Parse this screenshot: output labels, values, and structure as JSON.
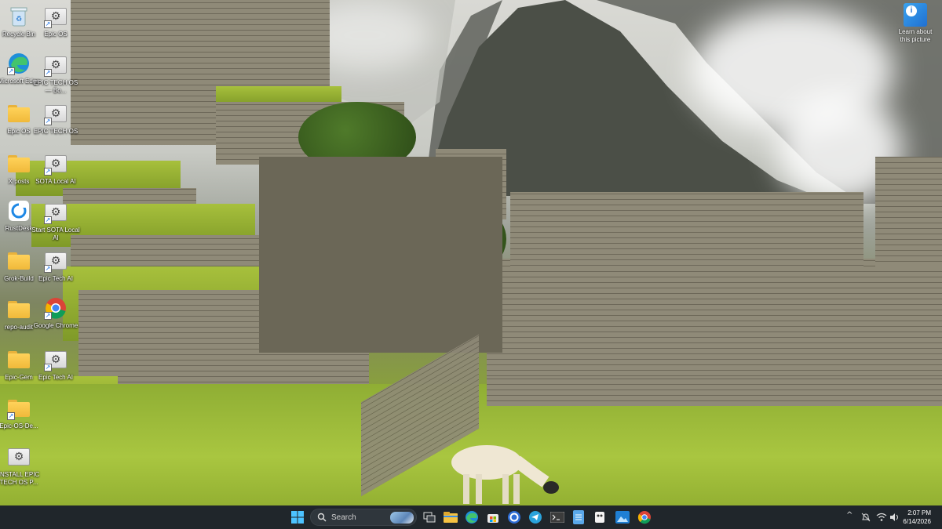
{
  "desktop": {
    "icons": [
      {
        "label": "Recycle Bin",
        "icon": "recycle-bin-icon"
      },
      {
        "label": "Epic OS",
        "icon": "settings-tile-icon"
      },
      {
        "label": "Microsoft Edge",
        "icon": "edge-icon"
      },
      {
        "label": "EPIC TECH OS — Bo...",
        "icon": "settings-tile-icon"
      },
      {
        "label": "Epic OS",
        "icon": "folder-icon"
      },
      {
        "label": "EPIC TECH OS",
        "icon": "settings-tile-icon"
      },
      {
        "label": "X posts",
        "icon": "folder-icon"
      },
      {
        "label": "SOTA Local AI",
        "icon": "settings-tile-icon"
      },
      {
        "label": "RustDesk",
        "icon": "rustdesk-icon"
      },
      {
        "label": "Start SOTA Local AI",
        "icon": "settings-tile-icon"
      },
      {
        "label": "Grok-Build",
        "icon": "folder-icon"
      },
      {
        "label": "Epic Tech AI",
        "icon": "settings-tile-icon"
      },
      {
        "label": "repo-audit",
        "icon": "folder-icon"
      },
      {
        "label": "Google Chrome",
        "icon": "chrome-icon"
      },
      {
        "label": "Epic-Gem",
        "icon": "folder-icon"
      },
      {
        "label": "Epic Tech AI",
        "icon": "settings-tile-icon"
      },
      {
        "label": "Epic-OS-De...",
        "icon": "folder-icon"
      },
      {
        "label": "INSTALL EPIC TECH OS P...",
        "icon": "settings-tile-icon"
      }
    ],
    "learn_picture": {
      "label": "Learn about this picture",
      "icon": "info-icon"
    }
  },
  "taskbar": {
    "search_label": "Search",
    "pinned": [
      "start-icon",
      "search",
      "task-view-icon",
      "file-explorer-icon",
      "edge-icon",
      "store-icon",
      "rustdesk-icon",
      "telegram-icon",
      "terminal-icon",
      "notepad-icon",
      "snipping-icon",
      "photos-icon",
      "chrome-icon"
    ],
    "tray": {
      "chevron": "^",
      "time": "2:07 PM",
      "date": "6/14/2026"
    }
  },
  "colors": {
    "taskbar": "#20262b",
    "accent": "#1a73e8"
  }
}
